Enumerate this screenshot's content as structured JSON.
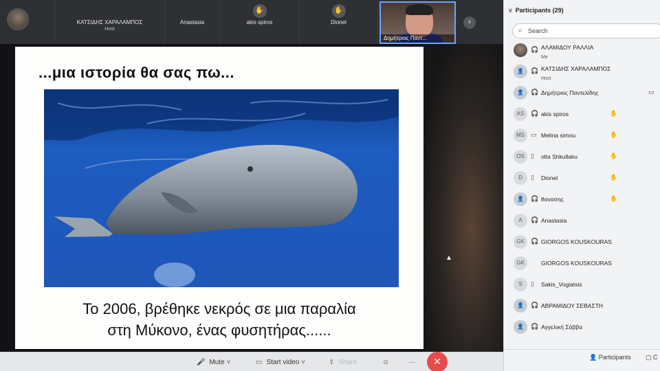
{
  "top_strip": {
    "tiles": [
      {
        "name": "ΚΑΤΣΙΔΗΣ ΧΑΡΑΛΑΜΠΟΣ",
        "sub": "Host"
      },
      {
        "name": "Anastasia"
      },
      {
        "name": "akis spiros",
        "hand": "✋"
      },
      {
        "name": "Dionel",
        "hand": "✋"
      }
    ],
    "speaker_label": "Δημήτριος Παντ...",
    "next_icon": "›"
  },
  "slide": {
    "title": "...μια ιστορία θα σας πω...",
    "caption_line1": "Το 2006, βρέθηκε νεκρός σε μια παραλία",
    "caption_line2": "στη Μύκονο, ένας φυσητήρας......"
  },
  "panel": {
    "title": "Participants (29)",
    "chevron": "∨",
    "search_placeholder": "Search",
    "search_icon": "⌕",
    "participants": [
      {
        "initials": "",
        "avatar": "photo",
        "name": "ΑΛΑΜΙΔΟΥ ΡΑΛΛΙΑ",
        "sub": "Me",
        "mic": "🎧"
      },
      {
        "initials": "",
        "avatar": "person",
        "name": "ΚΑΤΣΙΔΗΣ ΧΑΡΑΛΑΜΠΟΣ",
        "sub": "Host",
        "mic": "🎧"
      },
      {
        "initials": "",
        "avatar": "person",
        "name": "Δημήτριος Παντελίδης",
        "mic": "🎧",
        "cam": "▭"
      },
      {
        "initials": "AS",
        "name": "akis spiros",
        "mic": "🎧",
        "raise": "✋"
      },
      {
        "initials": "MS",
        "name": "Melina simou",
        "mic": "▭",
        "raise": "✋"
      },
      {
        "initials": "OS",
        "name": "olta Shkullaku",
        "mic": "▯",
        "raise": "✋"
      },
      {
        "initials": "D",
        "name": "Dionel",
        "mic": "▯",
        "raise": "✋"
      },
      {
        "initials": "",
        "avatar": "person",
        "name": "θανασης",
        "mic": "🎧",
        "raise": "✋"
      },
      {
        "initials": "A",
        "name": "Anastasia",
        "mic": "🎧"
      },
      {
        "initials": "GK",
        "name": "GIORGOS KOUSKOURAS",
        "mic": "🎧"
      },
      {
        "initials": "GK",
        "name": "GIORGOS KOUSKOURAS",
        "mic": ""
      },
      {
        "initials": "S",
        "name": "Sakis_Vogiatsis",
        "mic": "▯"
      },
      {
        "initials": "",
        "avatar": "person",
        "name": "ΑΒΡΑΜΙΔΟΥ ΣΕΒΑΣΤΗ",
        "mic": "🎧"
      },
      {
        "initials": "",
        "avatar": "person",
        "name": "Αγγελική Σάββα",
        "mic": "🎧"
      }
    ],
    "footer_participants": "Participants",
    "footer_chat": "C"
  },
  "toolbar": {
    "mute_label": "Mute",
    "start_video_label": "Start video",
    "share_label": "Share",
    "more_icon": "···",
    "leave_icon": "✕"
  },
  "colors": {
    "accent": "#6aa5ff",
    "leave": "#e74c4c",
    "ocean": "#1f56b8"
  }
}
